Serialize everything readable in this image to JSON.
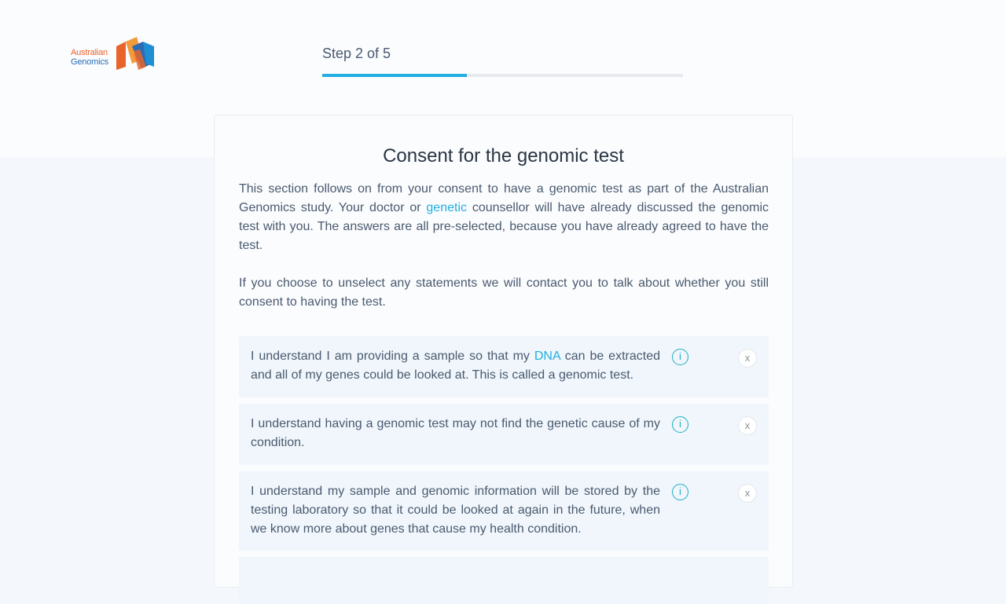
{
  "brand": {
    "name_line1": "Australian",
    "name_line2": "Genomics",
    "colors": {
      "orange": "#e8642a",
      "blue": "#2a6db5"
    }
  },
  "progress": {
    "label": "Step 2 of 5",
    "fraction": 0.4,
    "fill_color": "#22aee0"
  },
  "consent": {
    "title": "Consent for the genomic test",
    "intro": {
      "part1": "This section follows on from your consent to have a genomic test as part of the Australian Genomics study. Your doctor or ",
      "link": "genetic",
      "part2": " counsellor will have already discussed the genomic test with you. The answers are all pre-selected, because you have already agreed to have the test."
    },
    "note": "If you choose to unselect any statements we will contact you to talk about whether you still consent to having the test.",
    "items": [
      {
        "text_before": "I understand I am providing a sample so that my ",
        "link": "DNA",
        "text_after": " can be extracted and all of my genes could be looked at. This is called a genomic test.",
        "info_label": "i",
        "remove_label": "x"
      },
      {
        "text": "I understand having a genomic test may not find the genetic cause of my condition.",
        "info_label": "i",
        "remove_label": "x"
      },
      {
        "text": "I understand my sample and genomic information will be stored by the testing laboratory so that it could be looked at again in the future, when we know more about genes that cause my health condition.",
        "info_label": "i",
        "remove_label": "x"
      }
    ]
  }
}
